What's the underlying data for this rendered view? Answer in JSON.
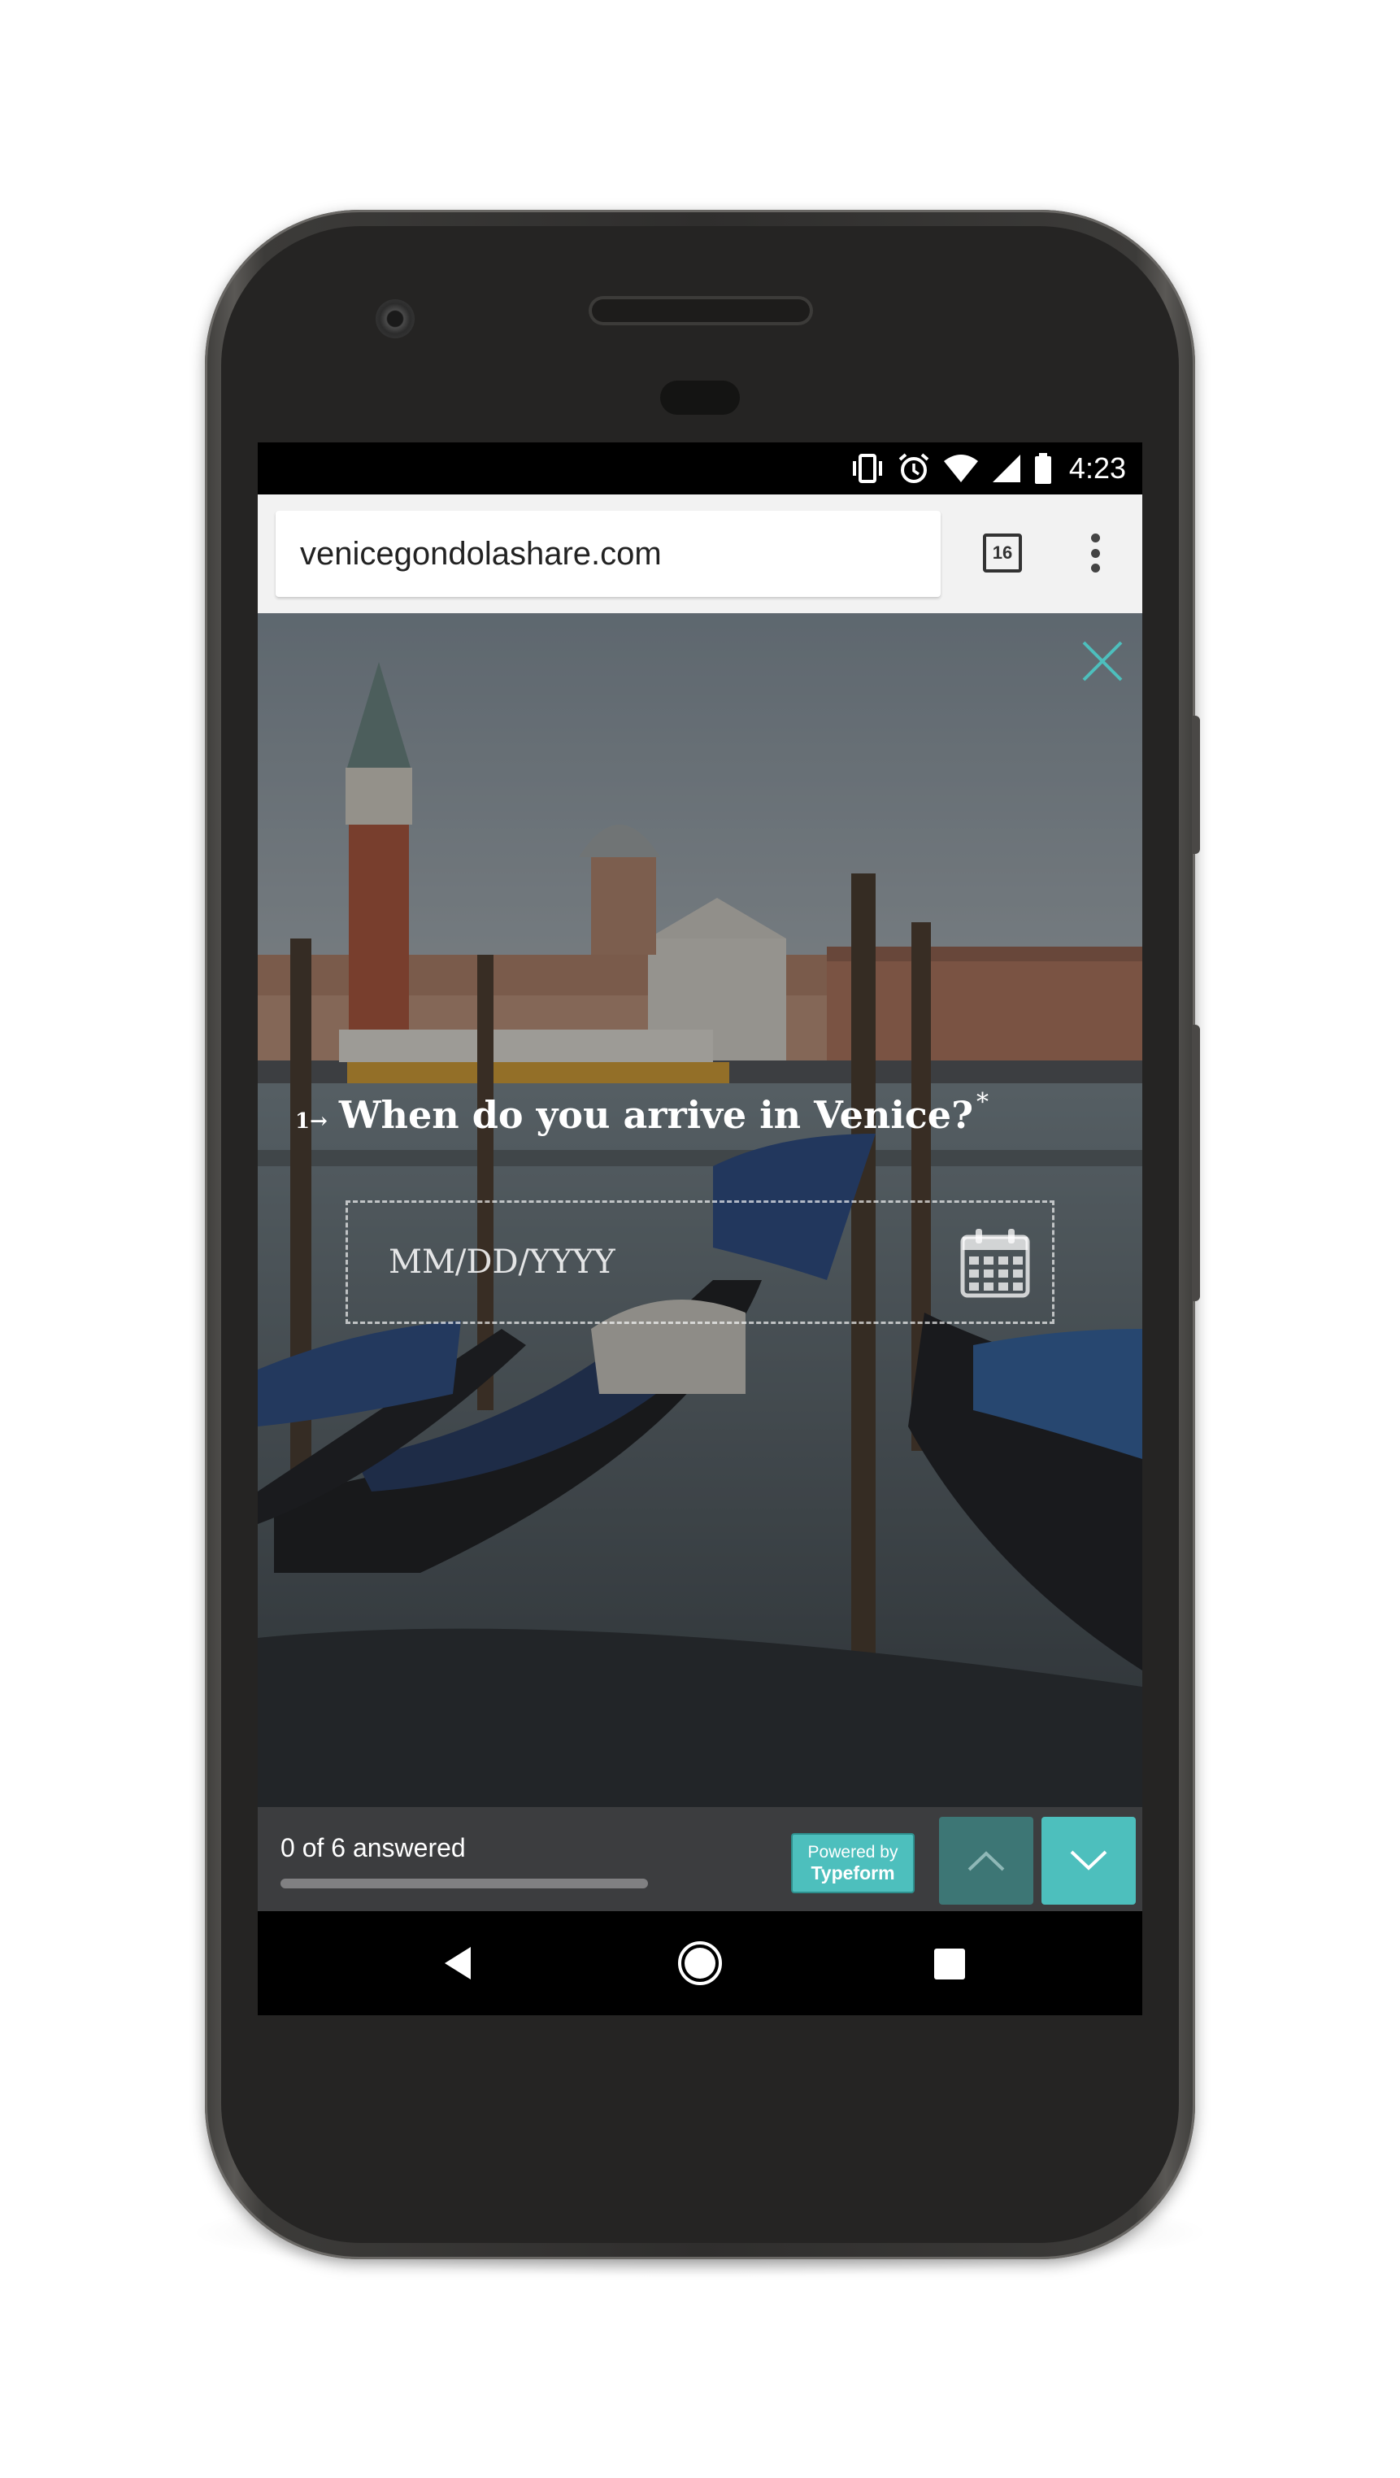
{
  "status_bar": {
    "time": "4:23",
    "icons": [
      "vibrate-icon",
      "alarm-icon",
      "wifi-icon",
      "signal-icon",
      "battery-icon"
    ]
  },
  "browser": {
    "url": "venicegondolashare.com",
    "tab_count": "16",
    "menu_icon": "more-vert-icon"
  },
  "form": {
    "question_number": "1",
    "question_text": "When do you arrive in Venice?",
    "required_marker": "*",
    "date_placeholder": "MM/DD/YYYY",
    "close_icon": "close-icon",
    "calendar_icon": "calendar-icon"
  },
  "footer": {
    "answered_text": "0 of 6 answered",
    "progress_fraction": 0,
    "powered_by_line1": "Powered by",
    "powered_by_line2": "Typeform",
    "up_icon": "chevron-up-icon",
    "down_icon": "chevron-down-icon"
  },
  "colors": {
    "accent": "#4dbfbd",
    "accent_dark": "#3d7675",
    "footer_bg": "#3c3d3f",
    "url_bar_bg": "#f2f2f2"
  },
  "android_nav": {
    "back_icon": "back-icon",
    "home_icon": "home-icon",
    "recents_icon": "recents-icon"
  }
}
